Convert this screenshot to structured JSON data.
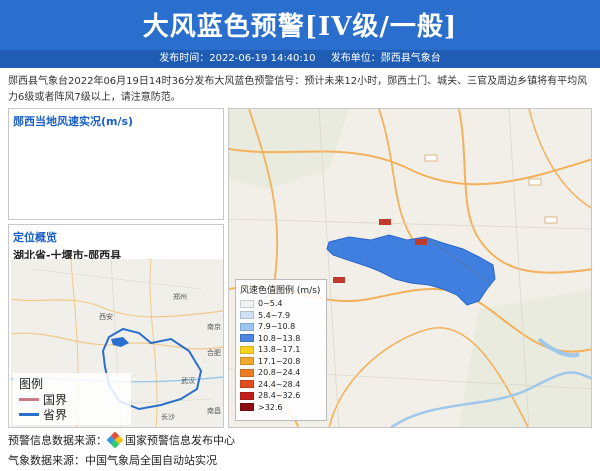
{
  "header": {
    "title": "大风蓝色预警[IV级/一般]",
    "publish_time": "发布时间：2022-06-19 14:40:10",
    "publisher": "发布单位：郧西县气象台"
  },
  "description": "郧西县气象台2022年06月19日14时36分发布大风蓝色预警信号：预计未来12小时，郧西土门、城关、三官及周边乡镇将有平均风力6级或者阵风7级以上，请注意防范。",
  "wind_panel": {
    "title": "郧西当地风速实况(m/s)"
  },
  "location_panel": {
    "title": "定位概览",
    "path": "湖北省-十堰市-郧西县",
    "legend_title": "图例",
    "legend_items": [
      {
        "label": "国界",
        "color": "#c97b8a"
      },
      {
        "label": "省界",
        "color": "#2a6fcd"
      }
    ],
    "map_labels": [
      "西安",
      "郑州",
      "武汉",
      "长沙",
      "南昌",
      "合肥",
      "南京"
    ]
  },
  "wind_legend": {
    "title": "风速色值图例 (m/s)",
    "items": [
      {
        "label": "0~5.4",
        "color": "#eef3f8"
      },
      {
        "label": "5.4~7.9",
        "color": "#cfe2f5"
      },
      {
        "label": "7.9~10.8",
        "color": "#9cc6ef"
      },
      {
        "label": "10.8~13.8",
        "color": "#4b87e0"
      },
      {
        "label": "13.8~17.1",
        "color": "#f6d21f"
      },
      {
        "label": "17.1~20.8",
        "color": "#f2a72d"
      },
      {
        "label": "20.8~24.4",
        "color": "#ee7d22"
      },
      {
        "label": "24.4~28.4",
        "color": "#e14c1f"
      },
      {
        "label": "28.4~32.6",
        "color": "#c21e1b"
      },
      {
        "label": ">32.6",
        "color": "#8c0f12"
      }
    ]
  },
  "sources": {
    "warning_label": "预警信息数据来源：",
    "warning_source": "国家预警信息发布中心",
    "weather_label": "气象数据来源：",
    "weather_source": "中国气象局全国自动站实况"
  },
  "colors": {
    "header_bg": "#2a6fcd",
    "warning_region": "#3f7fe0",
    "accent": "#1a5fc8"
  }
}
